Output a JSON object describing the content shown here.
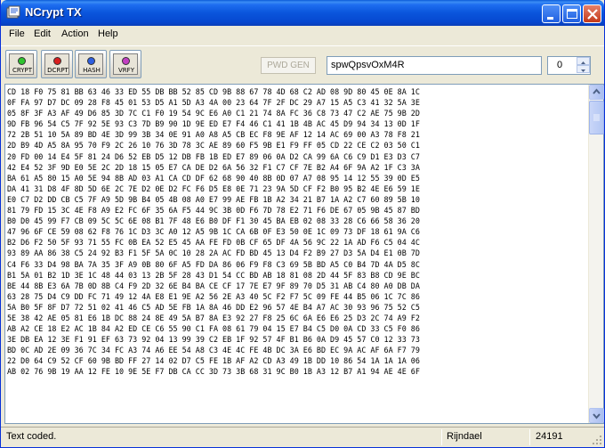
{
  "window": {
    "title": "NCrypt TX"
  },
  "menu": [
    "File",
    "Edit",
    "Action",
    "Help"
  ],
  "toolbar": {
    "buttons": [
      {
        "label": "CRYPT",
        "dot_color": "#2fc42f"
      },
      {
        "label": "DCRPT",
        "dot_color": "#d81e1e"
      },
      {
        "label": "HASH",
        "dot_color": "#2f5fe0"
      },
      {
        "label": "VRFY",
        "dot_color": "#c23fc2"
      }
    ],
    "pwd_gen_label": "PWD GEN",
    "password_value": "spwQpsvOxM4R",
    "spinner_value": "0"
  },
  "hex_lines": [
    "CD 18 F0 75 81 BB 63 46 33 ED 55 DB BB 52 85 CD 9B 88 67 78 4D 68 C2 AD 08 9D 80 45 0E 8A 1C",
    "0F FA 97 D7 DC 09 28 F8 45 01 53 D5 A1 5D A3 4A 00 23 64 7F 2F DC 29 A7 15 A5 C3 41 32 5A 3E",
    "05 8F 3F A3 AF 49 D6 85 3D 7C C1 F0 19 54 9C E6 A0 C1 21 74 8A FC 36 C8 73 47 C2 AE 75 9B 2D",
    "9D FB 96 54 C5 7F 92 5E 93 C3 7D B9 90 1D 9E ED E7 F4 46 C1 41 1B 4B AC 45 D9 94 34 13 0D 1F",
    "72 2B 51 10 5A 89 BD 4E 3D 99 3B 34 0E 91 A0 A8 A5 CB EC F8 9E AF 12 14 AC 69 00 A3 78 F8 21",
    "2D B9 4D A5 8A 95 70 F9 2C 26 10 76 3D 78 3C AE 89 60 F5 9B E1 F9 FF 05 CD 22 CE C2 03 50 C1",
    "20 FD 00 14 E4 5F 81 24 D6 52 EB D5 12 DB FB 1B ED E7 89 06 0A D2 CA 99 6A C6 C9 D1 E3 D3 C7",
    "42 E4 52 3F 9D E0 5E 2C 2D 18 15 05 E7 CA DE D2 6A 56 32 F1 C7 CF 7E B2 A4 6F 9A A2 1F C3 3A",
    "BA 61 A5 80 15 A0 5E 94 8B AD 03 A1 CA CD DF 62 68 90 40 8B 0D 07 A7 08 95 14 12 55 39 0D E5",
    "DA 41 31 D8 4F 8D 5D 6E 2C 7E D2 0E D2 FC F6 D5 E8 0E 71 23 9A 5D CF F2 B0 95 B2 4E E6 59 1E",
    "E0 C7 D2 DD CB C5 7F A9 5D 9B B4 05 4B 08 A0 E7 99 AE FB 1B A2 34 21 B7 1A A2 C7 60 89 5B 10",
    "81 79 FD 15 3C 4E F8 A9 E2 FC 6F 35 6A F5 44 9C 3B 0D F6 7D 78 E2 71 F6 DE 67 05 9B 45 87 BD",
    "B0 D0 45 99 F7 CB 09 5C 5C 6E 08 B1 7F 48 E6 B0 DF F1 30 45 BA EB 02 08 33 28 C6 66 58 36 20",
    "47 96 6F CE 59 08 62 F8 76 1C D3 3C A0 12 A5 9B 1C CA 6B 0F E3 50 0E 1C 09 73 DF 18 61 9A C6",
    "B2 D6 F2 50 5F 93 71 55 FC 0B EA 52 E5 45 AA FE FD 0B CF 65 DF 4A 56 9C 22 1A AD F6 C5 04 4C",
    "93 89 AA 86 38 C5 24 92 B3 F1 5F 5A 0C 10 28 2A AC FD BD 45 13 D4 F2 B9 27 D3 5A D4 E1 0B 7D",
    "C4 F6 33 D4 98 BA 7A 35 3F A9 0B 80 6F A5 FD DA 86 06 F9 F8 C3 69 5B BD A5 C0 B4 7D 4A D5 8C",
    "B1 5A 01 B2 1D 3E 1C 48 44 03 13 2B 5F 28 43 D1 54 CC BD AB 18 81 08 2D 44 5F 83 B8 CD 9E BC",
    "BE 44 8B E3 6A 7B 0D 8B C4 F9 2D 32 6E B4 BA CE CF 17 7E E7 9F 89 70 D5 31 AB C4 80 A0 DB DA",
    "63 28 75 D4 C9 DD FC 71 49 12 4A E8 E1 9E A2 56 2E A3 40 5C F2 F7 5C 09 FE 44 B5 06 1C 7C 86",
    "5A B0 5F 8F D7 72 51 02 41 46 C5 AD 5E FB 1A 8A 46 DD E2 96 57 4E B4 A7 AC 30 93 96 75 52 C5",
    "5E 38 42 AE 05 81 E6 1B DC 88 24 8E 49 5A B7 8A E3 92 27 F8 25 6C 6A E6 E6 25 D3 2C 74 A9 F2",
    "AB A2 CE 18 E2 AC 1B 84 A2 ED CE C6 55 90 C1 FA 08 61 79 04 15 E7 B4 C5 D0 0A CD 33 C5 F0 86",
    "3E DB EA 12 3E F1 91 EF 63 73 92 04 13 99 39 C2 EB 1F 92 57 4F B1 B6 0A D9 45 57 C0 12 33 73",
    "BD 0C AD 2E 09 36 7C 34 FC A3 74 A6 EE 54 A8 C3 4E 4C FE 4B DC 3A E6 BD EC 9A AC AF 6A F7 79",
    "22 D0 64 C9 52 CF 60 9B BD FF 27 14 02 D7 C5 FE 1B AF A2 CD A3 49 1B DD 10 86 54 1A 1A 1A 06",
    "AB 02 76 9B 19 AA 12 FE 10 9E 5E F7 DB CA CC 3D 73 3B 68 31 9C B0 1B A3 12 B7 A1 94 AE 4E 6F"
  ],
  "status": {
    "message": "Text coded.",
    "algorithm": "Rijndael",
    "count": "24191"
  }
}
